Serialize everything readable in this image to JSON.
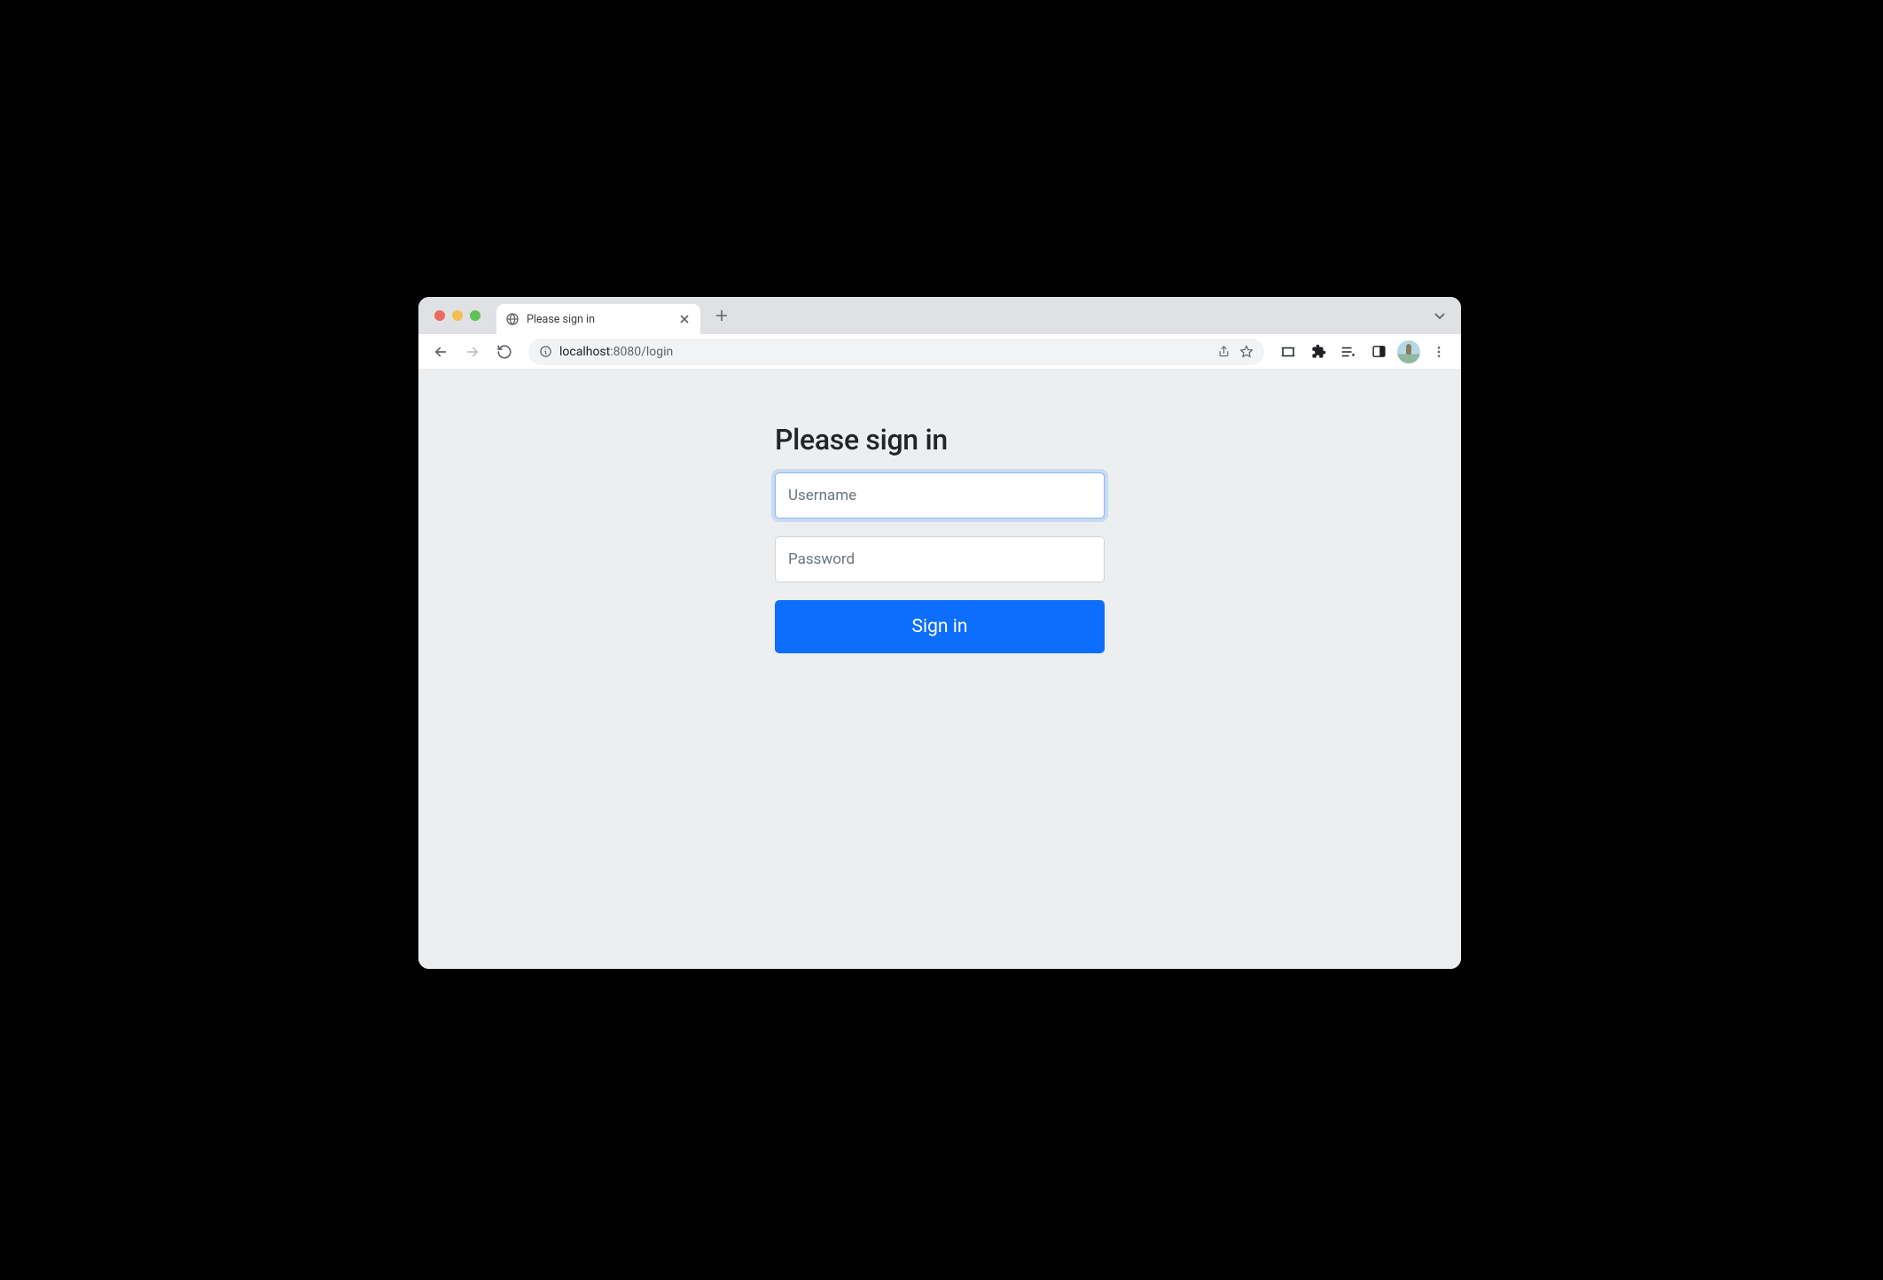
{
  "browser": {
    "tab": {
      "title": "Please sign in"
    },
    "address": {
      "host": "localhost",
      "port_path": ":8080/login"
    }
  },
  "page": {
    "heading": "Please sign in",
    "username": {
      "placeholder": "Username",
      "value": ""
    },
    "password": {
      "placeholder": "Password",
      "value": ""
    },
    "submit_label": "Sign in"
  },
  "colors": {
    "primary": "#0d6efd",
    "page_bg": "#eceeef"
  }
}
